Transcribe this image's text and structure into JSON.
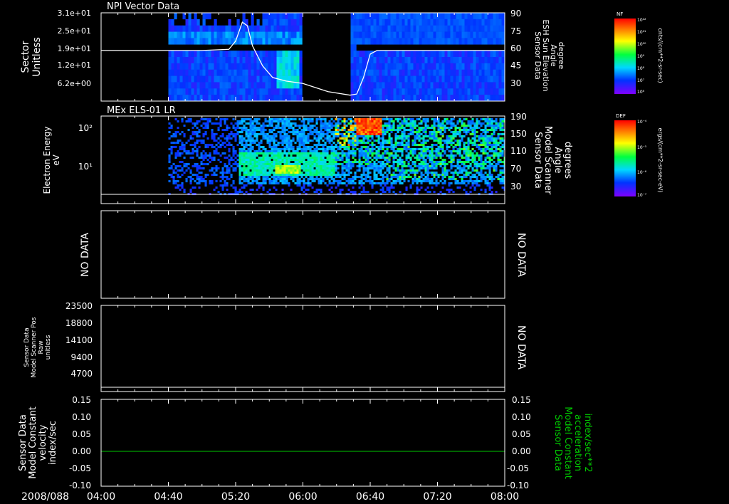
{
  "date_label": "2008/088",
  "time_ticks": [
    "04:00",
    "04:40",
    "05:20",
    "06:00",
    "06:40",
    "07:20",
    "08:00"
  ],
  "panels": [
    {
      "id": "npi",
      "title": "NPI Vector Data",
      "left_ylabel": [
        "Sector",
        "Unitless"
      ],
      "left_ticks": [
        "3.1e+01",
        "2.5e+01",
        "1.9e+01",
        "1.2e+01",
        "6.2e+00"
      ],
      "right_ylabel": [
        "Sensor Data",
        "ESH Sun Elevation",
        "Angle",
        "degree"
      ],
      "right_ticks": [
        "90",
        "75",
        "60",
        "45",
        "30"
      ],
      "colorbar": {
        "title": "NF",
        "unit": "cnts/(cm**2-sr-sec)",
        "ticks": [
          "10¹²",
          "10¹¹",
          "10¹⁰",
          "10⁹",
          "10⁸",
          "10⁷",
          "10⁶"
        ]
      }
    },
    {
      "id": "els",
      "title": "MEx ELS-01 LR",
      "left_ylabel": [
        "Electron Energy",
        "eV"
      ],
      "left_ticks": [
        "10²",
        "10¹"
      ],
      "right_ylabel": [
        "Sensor Data",
        "Model Scanner",
        "Angle",
        "degrees"
      ],
      "right_ticks": [
        "190",
        "150",
        "110",
        "70",
        "30"
      ],
      "colorbar": {
        "title": "DEF",
        "unit": "ergs/(cm**2-sr-sec-eV)",
        "ticks": [
          "10⁻⁴",
          "10⁻⁵",
          "10⁻⁶",
          "10⁻⁷"
        ]
      }
    },
    {
      "id": "nodata",
      "left_nodata": "NO DATA",
      "right_nodata": "NO DATA"
    },
    {
      "id": "scanpos",
      "left_ylabel": [
        "Sensor Data",
        "Model Scanner Pos",
        "Raw",
        "unitless"
      ],
      "left_ticks": [
        "23500",
        "18800",
        "14100",
        "9400",
        "4700"
      ],
      "right_nodata": "NO DATA"
    },
    {
      "id": "velocity",
      "left_ylabel": [
        "Sensor Data",
        "Model Constant",
        "velocity",
        "index/sec"
      ],
      "left_ticks": [
        "0.15",
        "0.10",
        "0.05",
        "0.00",
        "-0.05",
        "-0.10"
      ],
      "right_ylabel": [
        "Sensor Data",
        "Model Constant",
        "acceleration",
        "index/sec**2"
      ],
      "right_ticks": [
        "0.15",
        "0.10",
        "0.05",
        "0.00",
        "-0.05",
        "-0.10"
      ]
    }
  ],
  "chart_data": [
    {
      "type": "heatmap",
      "title": "NPI Vector Data",
      "ylabel": "Sector Unitless",
      "x_range": [
        "04:00",
        "08:00"
      ],
      "y_ticks": [
        31,
        25,
        19,
        12,
        6.2
      ],
      "data_start": "04:40",
      "gap": [
        "06:00",
        "06:28"
      ],
      "overlay_series": {
        "name": "Sensor Data ESH Sun Elevation Angle",
        "unit": "degree",
        "y_range": [
          15,
          90
        ],
        "points": [
          [
            "04:00",
            58
          ],
          [
            "04:40",
            58
          ],
          [
            "05:00",
            58
          ],
          [
            "05:16",
            59
          ],
          [
            "05:20",
            66
          ],
          [
            "05:24",
            82
          ],
          [
            "05:27",
            79
          ],
          [
            "05:30",
            62
          ],
          [
            "05:36",
            45
          ],
          [
            "05:42",
            35
          ],
          [
            "05:50",
            32
          ],
          [
            "06:00",
            30
          ],
          [
            "06:15",
            23
          ],
          [
            "06:28",
            20
          ],
          [
            "06:32",
            21
          ],
          [
            "06:36",
            35
          ],
          [
            "06:40",
            55
          ],
          [
            "06:44",
            58
          ],
          [
            "08:00",
            58
          ]
        ]
      }
    },
    {
      "type": "heatmap",
      "title": "MEx ELS-01 LR",
      "ylabel": "Electron Energy eV",
      "x_range": [
        "04:00",
        "08:00"
      ],
      "y_scale": "log",
      "data_start": "04:40",
      "overlay_series": {
        "name": "Sensor Data Model Scanner Angle",
        "unit": "degrees",
        "y_range": [
          10,
          190
        ],
        "points": [
          [
            "04:00",
            18
          ],
          [
            "08:00",
            18
          ]
        ]
      }
    },
    {
      "type": "line",
      "ylabel": "Sensor Data Model Scanner Pos Raw unitless",
      "ylim": [
        0,
        23500
      ],
      "series": [
        {
          "x": [
            "04:00",
            "08:00"
          ],
          "values": [
            0,
            0
          ]
        }
      ]
    },
    {
      "type": "line",
      "ylabel": "Sensor Data Model Constant velocity index/sec",
      "ylim": [
        -0.1,
        0.15
      ],
      "series": [
        {
          "x": [
            "04:00",
            "08:00"
          ],
          "values": [
            0.0,
            0.0
          ]
        }
      ],
      "line_color": "#00c800"
    }
  ],
  "colors": {
    "axis": "#ffffff",
    "velocity_line": "#00c800",
    "right_label_green": "#00c800"
  }
}
